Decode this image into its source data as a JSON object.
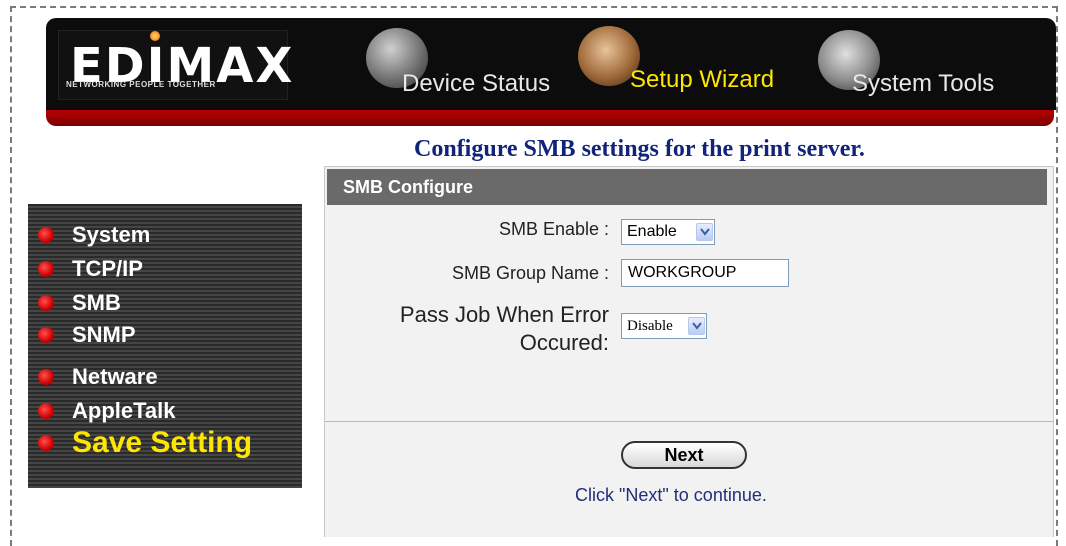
{
  "header": {
    "logo_text": "EDIMAX",
    "tagline": "NETWORKING PEOPLE TOGETHER",
    "nav": [
      {
        "label": "Device Status",
        "icon": "globe-icon",
        "active": false
      },
      {
        "label": "Setup Wizard",
        "icon": "hand-icon",
        "active": true
      },
      {
        "label": "System Tools",
        "icon": "tools-icon",
        "active": false
      }
    ]
  },
  "page_title": "Configure SMB settings for the print server.",
  "sidebar": {
    "items": [
      {
        "label": "System"
      },
      {
        "label": "TCP/IP"
      },
      {
        "label": "SMB"
      },
      {
        "label": "SNMP"
      },
      {
        "label": "Netware"
      },
      {
        "label": "AppleTalk"
      },
      {
        "label": "Save Setting"
      }
    ]
  },
  "panel": {
    "title": "SMB Configure",
    "smb_enable_label": "SMB Enable :",
    "smb_enable_value": "Enable",
    "group_name_label": "SMB Group Name :",
    "group_name_value": "WORKGROUP",
    "pass_job_label_1": "Pass Job When Error",
    "pass_job_label_2": "Occured:",
    "pass_job_value": "Disable",
    "next_label": "Next",
    "hint": "Click \"Next\" to continue."
  },
  "colors": {
    "accent_yellow": "#ffe600",
    "title_blue": "#12247a",
    "header_red": "#b80000"
  }
}
